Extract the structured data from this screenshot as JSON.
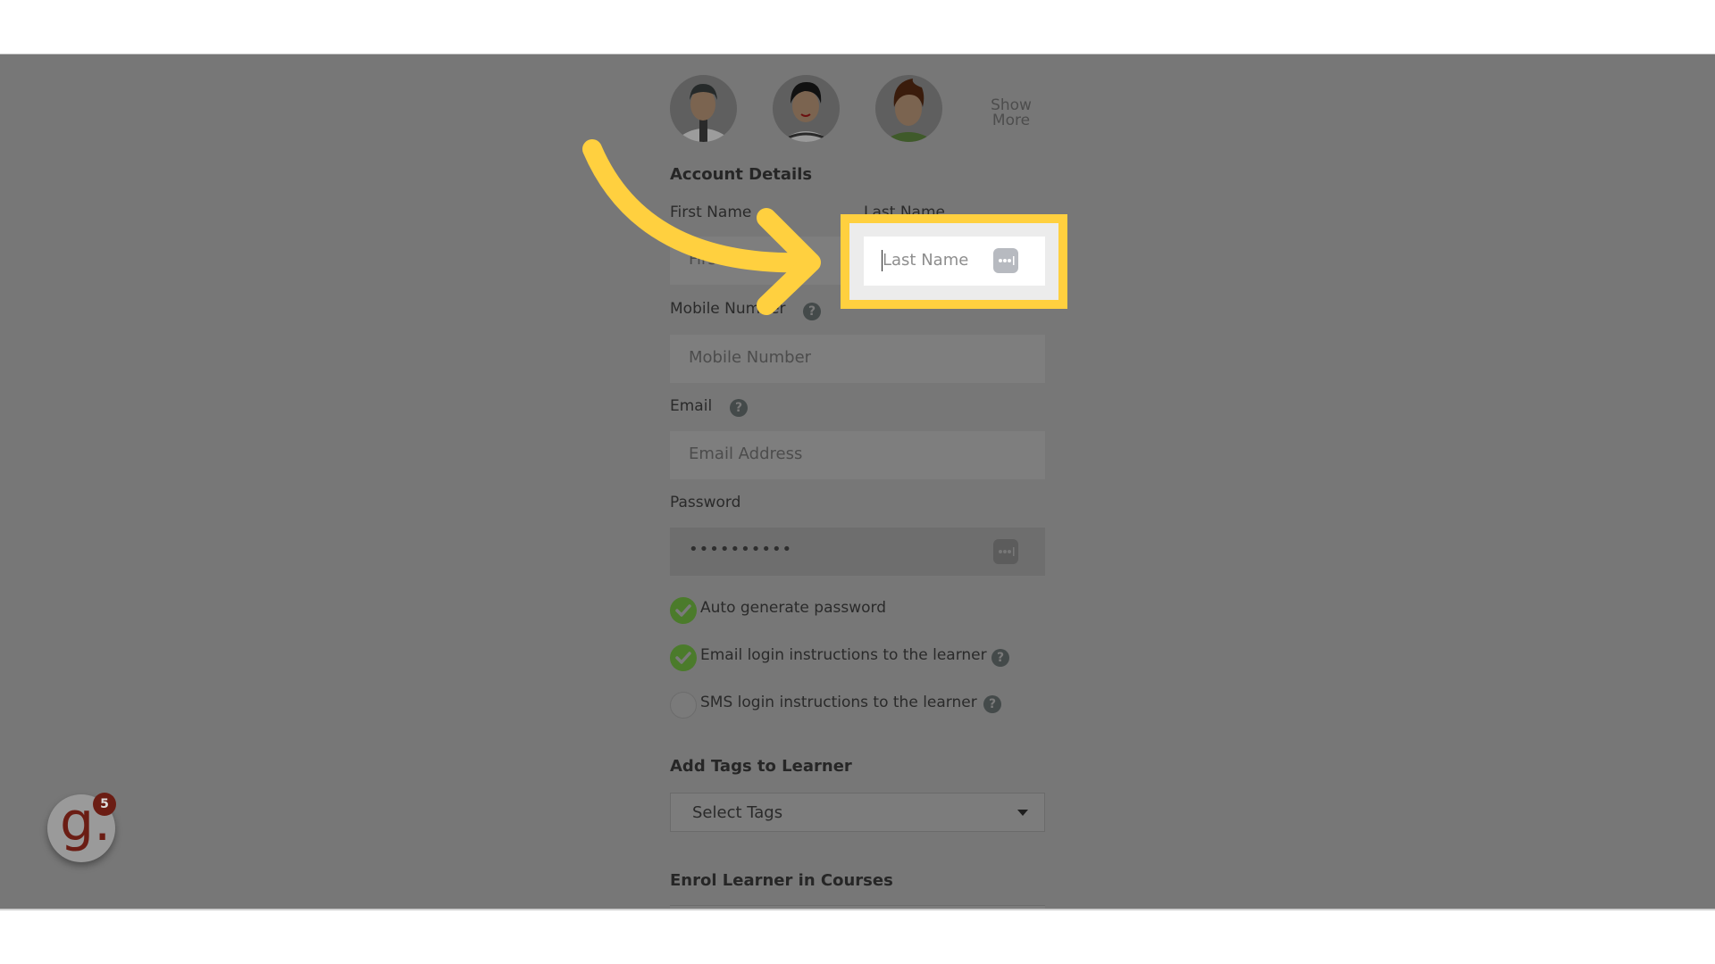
{
  "avatars": {
    "row_partial": [
      "avatar-option-1",
      "avatar-option-2",
      "avatar-option-3",
      "avatar-option-4"
    ],
    "row_visible": [
      "male-avatar-tie",
      "female-avatar",
      "male-avatar-green-shirt"
    ],
    "show_more_line1": "Show",
    "show_more_line2": "More"
  },
  "account_details": {
    "heading": "Account Details",
    "first_name": {
      "label": "First Name",
      "placeholder": "First Name",
      "value": ""
    },
    "last_name": {
      "label": "Last Name",
      "placeholder": "Last Name",
      "value": "",
      "focused": true
    },
    "mobile": {
      "label": "Mobile Number",
      "placeholder": "Mobile Number",
      "value": "",
      "help_icon": "?"
    },
    "email": {
      "label": "Email",
      "placeholder": "Email Address",
      "value": "",
      "help_icon": "?"
    },
    "password": {
      "label": "Password",
      "value": "••••••••••"
    },
    "options": [
      {
        "label": "Auto generate password",
        "checked": true,
        "help": false
      },
      {
        "label": "Email login instructions to the learner",
        "checked": true,
        "help": true
      },
      {
        "label": "SMS login instructions to the learner",
        "checked": false,
        "help": true
      }
    ]
  },
  "tags": {
    "heading": "Add Tags to Learner",
    "select_placeholder": "Select Tags"
  },
  "courses": {
    "heading": "Enrol Learner in Courses"
  },
  "help_widget": {
    "logo_letter": "g.",
    "notification_count": "5"
  },
  "colors": {
    "highlight": "#ffd03f",
    "overlay": "#777777",
    "check_on": "#4b7b2b",
    "brand": "#6b1d14"
  }
}
